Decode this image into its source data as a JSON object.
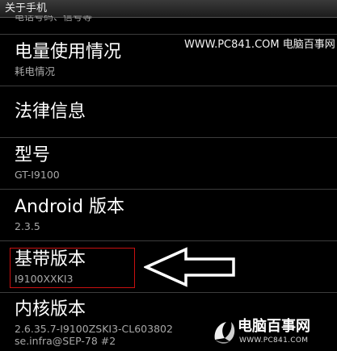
{
  "titlebar": {
    "title": "关于手机"
  },
  "cutoff_sub": "电话号码、信号等",
  "watermark": {
    "site": "WWW.PC841.COM 电脑百事网",
    "logo_title": "电脑百事网",
    "logo_url": "WWW.PC841.COM"
  },
  "items": [
    {
      "label": "电量使用情况",
      "sub": "耗电情况"
    },
    {
      "label": "法律信息"
    },
    {
      "label": "型号",
      "sub": "GT-I9100"
    },
    {
      "label": "Android 版本",
      "sub": "2.3.5"
    },
    {
      "label": "基带版本",
      "sub": "I9100XXKI3"
    },
    {
      "label": "内核版本",
      "sub": "2.6.35.7-I9100ZSKI3-CL603802",
      "sub2": "se.infra@SEP-78 #2"
    }
  ],
  "colors": {
    "highlight": "#c81010",
    "background": "#000000"
  }
}
